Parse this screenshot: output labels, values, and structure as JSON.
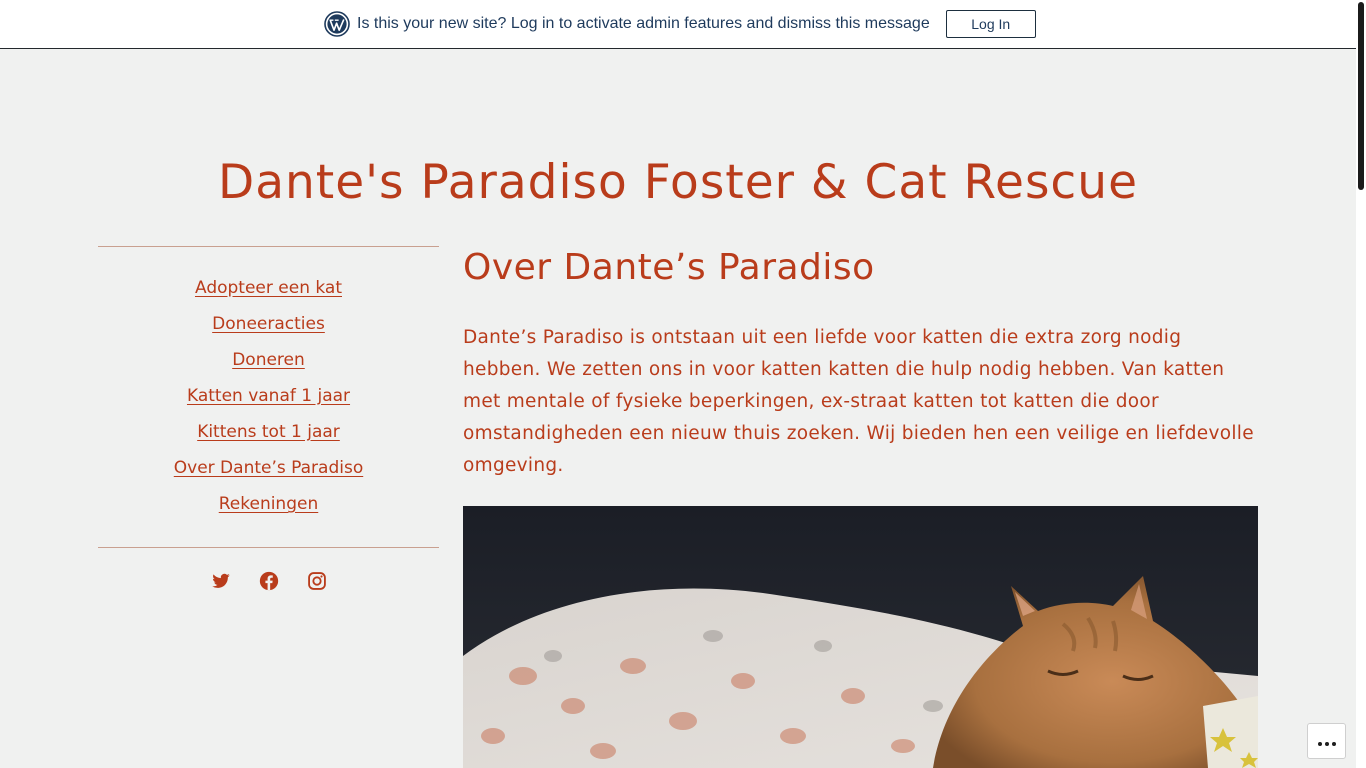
{
  "notice": {
    "message": "Is this your new site? Log in to activate admin features and dismiss this message",
    "login_label": "Log In"
  },
  "site": {
    "title": "Dante's Paradiso Foster & Cat Rescue"
  },
  "nav": {
    "items": [
      {
        "label": "Adopteer een kat"
      },
      {
        "label": "Doneeracties"
      },
      {
        "label": "Doneren"
      },
      {
        "label": "Katten vanaf 1 jaar"
      },
      {
        "label": "Kittens tot 1 jaar"
      },
      {
        "label": "Over Dante’s Paradiso"
      },
      {
        "label": "Rekeningen"
      }
    ]
  },
  "social": {
    "icons": [
      "twitter-icon",
      "facebook-icon",
      "instagram-icon"
    ]
  },
  "page": {
    "heading": "Over Dante’s Paradiso",
    "body": "Dante’s Paradiso is ontstaan uit een liefde voor katten die extra zorg nodig hebben. We zetten ons in voor katten katten die hulp nodig hebben. Van katten met mentale of fysieke beperkingen, ex-straat katten tot katten die door omstandigheden een nieuw thuis zoeken. Wij bieden hen een veilige en liefdevolle omgeving."
  },
  "colors": {
    "accent": "#b93c1b",
    "background": "#f0f1f0",
    "notice_text": "#1e3a5c"
  }
}
